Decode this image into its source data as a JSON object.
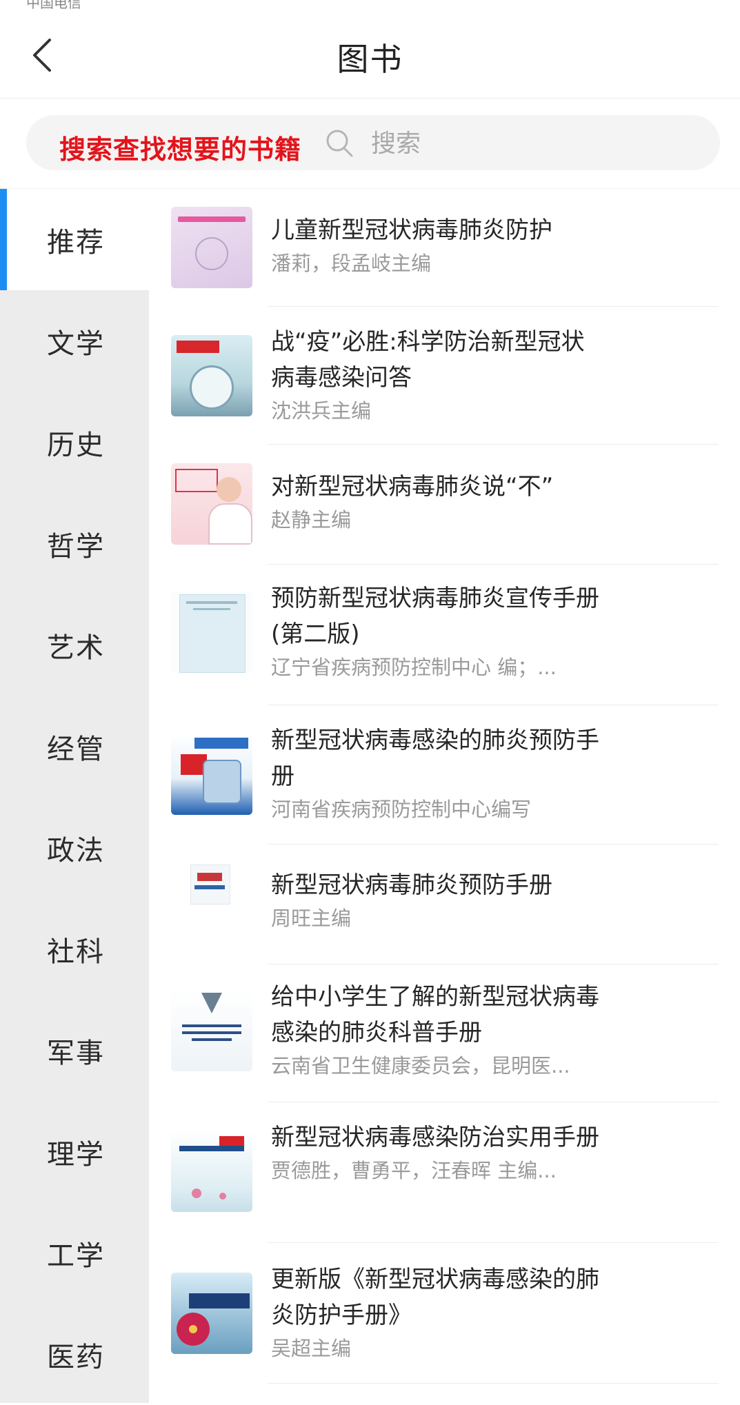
{
  "status_bar": {
    "carrier": "中国电信"
  },
  "header": {
    "title": "图书"
  },
  "search": {
    "promo_text": "搜索查找想要的书籍",
    "placeholder": "搜索"
  },
  "sidebar": {
    "items": [
      {
        "label": "推荐",
        "active": true
      },
      {
        "label": "文学"
      },
      {
        "label": "历史"
      },
      {
        "label": "哲学"
      },
      {
        "label": "艺术"
      },
      {
        "label": "经管"
      },
      {
        "label": "政法"
      },
      {
        "label": "社科"
      },
      {
        "label": "军事"
      },
      {
        "label": "理学"
      },
      {
        "label": "工学"
      },
      {
        "label": "医药"
      }
    ]
  },
  "books": [
    {
      "title": "儿童新型冠状病毒肺炎防护",
      "author": "潘莉，段孟岐主编"
    },
    {
      "title": "战“疫”必胜:科学防治新型冠状病毒感染问答",
      "author": "沈洪兵主编"
    },
    {
      "title": "对新型冠状病毒肺炎说“不”",
      "author": "赵静主编"
    },
    {
      "title": "预防新型冠状病毒肺炎宣传手册(第二版)",
      "author": "辽宁省疾病预防控制中心 编；..."
    },
    {
      "title": "新型冠状病毒感染的肺炎预防手册",
      "author": "河南省疾病预防控制中心编写"
    },
    {
      "title": "新型冠状病毒肺炎预防手册",
      "author": "周旺主编"
    },
    {
      "title": "给中小学生了解的新型冠状病毒感染的肺炎科普手册",
      "author": "云南省卫生健康委员会，昆明医..."
    },
    {
      "title": "新型冠状病毒感染防治实用手册",
      "author": "贾德胜，曹勇平，汪春晖 主编..."
    },
    {
      "title": "更新版《新型冠状病毒感染的肺炎防护手册》",
      "author": "吴超主编"
    }
  ],
  "colors": {
    "accent": "#1e8ef5",
    "promo": "#e3141b",
    "sidebar_bg": "#ececec"
  }
}
